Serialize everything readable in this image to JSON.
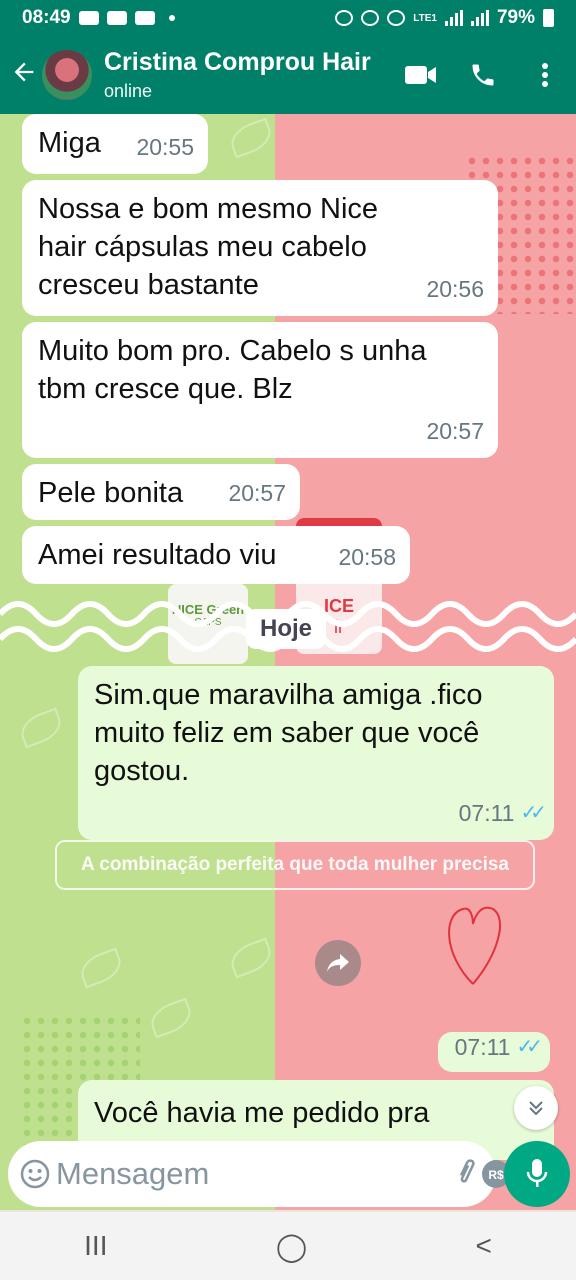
{
  "status_bar": {
    "time": "08:49",
    "battery": "79%",
    "network": "LTE1"
  },
  "header": {
    "contact_name": "Cristina Comprou Hair",
    "status": "online",
    "icons": [
      "back-arrow-icon",
      "video-call-icon",
      "phone-call-icon",
      "more-options-icon"
    ]
  },
  "messages": [
    {
      "dir": "in",
      "text": "Miga",
      "time": "20:55"
    },
    {
      "dir": "in",
      "text": "Nossa e bom mesmo Nice hair cápsulas meu cabelo cresceu bastante",
      "time": "20:56"
    },
    {
      "dir": "in",
      "text": "Muito bom pro. Cabelo s unha tbm cresce que. Blz",
      "time": "20:57"
    },
    {
      "dir": "in",
      "text": "Pele bonita",
      "time": "20:57"
    },
    {
      "dir": "in",
      "text": "Amei resultado viu",
      "time": "20:58"
    },
    {
      "dir": "out",
      "text": "Sim.que maravilha amiga .fico muito feliz em saber que você gostou.",
      "time": "07:11",
      "read": true
    },
    {
      "dir": "out",
      "text": "",
      "time": "07:11",
      "read": true
    },
    {
      "dir": "out",
      "text": "Você havia me pedido pra",
      "time": ""
    }
  ],
  "date_divider": "Hoje",
  "media": {
    "banner_text": "A combinação perfeita que toda mulher precisa",
    "product_label": "NICE Green",
    "product_sublabel": "CAPS",
    "product2_label": "ICE",
    "product2_sub": "ir"
  },
  "input": {
    "placeholder": "Mensagem",
    "value": ""
  },
  "colors": {
    "brand": "#008069",
    "accent": "#00a884",
    "bubble_out": "#e7fbd9",
    "ticks": "#4fb6ec"
  },
  "navbar": {
    "recents": "III",
    "home": "◯",
    "back": "<"
  }
}
